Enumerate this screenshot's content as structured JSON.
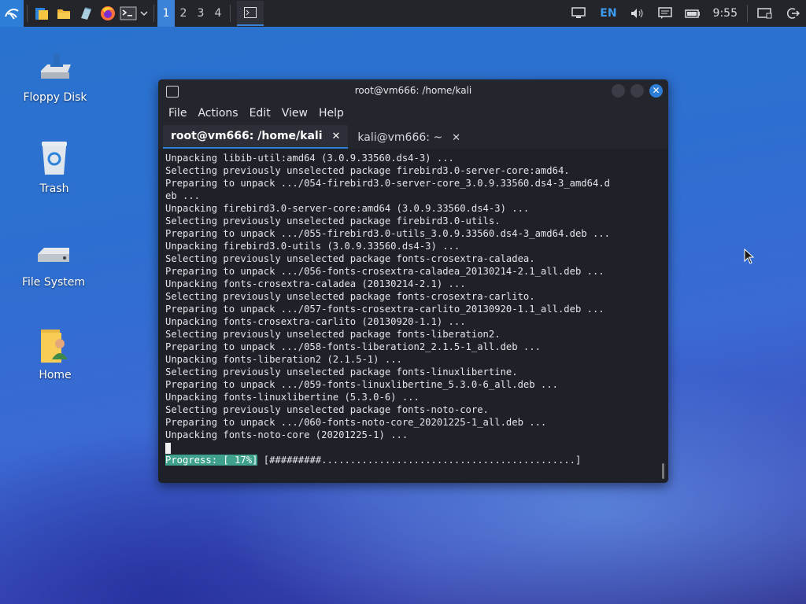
{
  "taskbar": {
    "workspaces": [
      "1",
      "2",
      "3",
      "4"
    ],
    "active_workspace": "1",
    "language": "EN",
    "clock": "9:55",
    "accent_color": "#3c82d8"
  },
  "desktop": {
    "icons": [
      {
        "label": "Floppy Disk",
        "icon": "floppy-disk-icon"
      },
      {
        "label": "Trash",
        "icon": "trash-icon"
      },
      {
        "label": "File System",
        "icon": "drive-icon"
      },
      {
        "label": "Home",
        "icon": "home-folder-icon"
      }
    ]
  },
  "terminal": {
    "title": "root@vm666: /home/kali",
    "menu": [
      "File",
      "Actions",
      "Edit",
      "View",
      "Help"
    ],
    "tabs": [
      {
        "label": "root@vm666: /home/kali",
        "close": "✕"
      },
      {
        "label": "kali@vm666: ~",
        "close": "✕"
      }
    ],
    "lines": [
      "Unpacking libib-util:amd64 (3.0.9.33560.ds4-3) ...",
      "Selecting previously unselected package firebird3.0-server-core:amd64.",
      "Preparing to unpack .../054-firebird3.0-server-core_3.0.9.33560.ds4-3_amd64.d",
      "eb ...",
      "Unpacking firebird3.0-server-core:amd64 (3.0.9.33560.ds4-3) ...",
      "Selecting previously unselected package firebird3.0-utils.",
      "Preparing to unpack .../055-firebird3.0-utils_3.0.9.33560.ds4-3_amd64.deb ...",
      "Unpacking firebird3.0-utils (3.0.9.33560.ds4-3) ...",
      "Selecting previously unselected package fonts-crosextra-caladea.",
      "Preparing to unpack .../056-fonts-crosextra-caladea_20130214-2.1_all.deb ...",
      "Unpacking fonts-crosextra-caladea (20130214-2.1) ...",
      "Selecting previously unselected package fonts-crosextra-carlito.",
      "Preparing to unpack .../057-fonts-crosextra-carlito_20130920-1.1_all.deb ...",
      "Unpacking fonts-crosextra-carlito (20130920-1.1) ...",
      "Selecting previously unselected package fonts-liberation2.",
      "Preparing to unpack .../058-fonts-liberation2_2.1.5-1_all.deb ...",
      "Unpacking fonts-liberation2 (2.1.5-1) ...",
      "Selecting previously unselected package fonts-linuxlibertine.",
      "Preparing to unpack .../059-fonts-linuxlibertine_5.3.0-6_all.deb ...",
      "Unpacking fonts-linuxlibertine (5.3.0-6) ...",
      "Selecting previously unselected package fonts-noto-core.",
      "Preparing to unpack .../060-fonts-noto-core_20201225-1_all.deb ...",
      "Unpacking fonts-noto-core (20201225-1) ..."
    ],
    "progress_label": "Progress: [ 17%]",
    "progress_bar": " [#########............................................]",
    "progress_fraction": 0.17
  }
}
